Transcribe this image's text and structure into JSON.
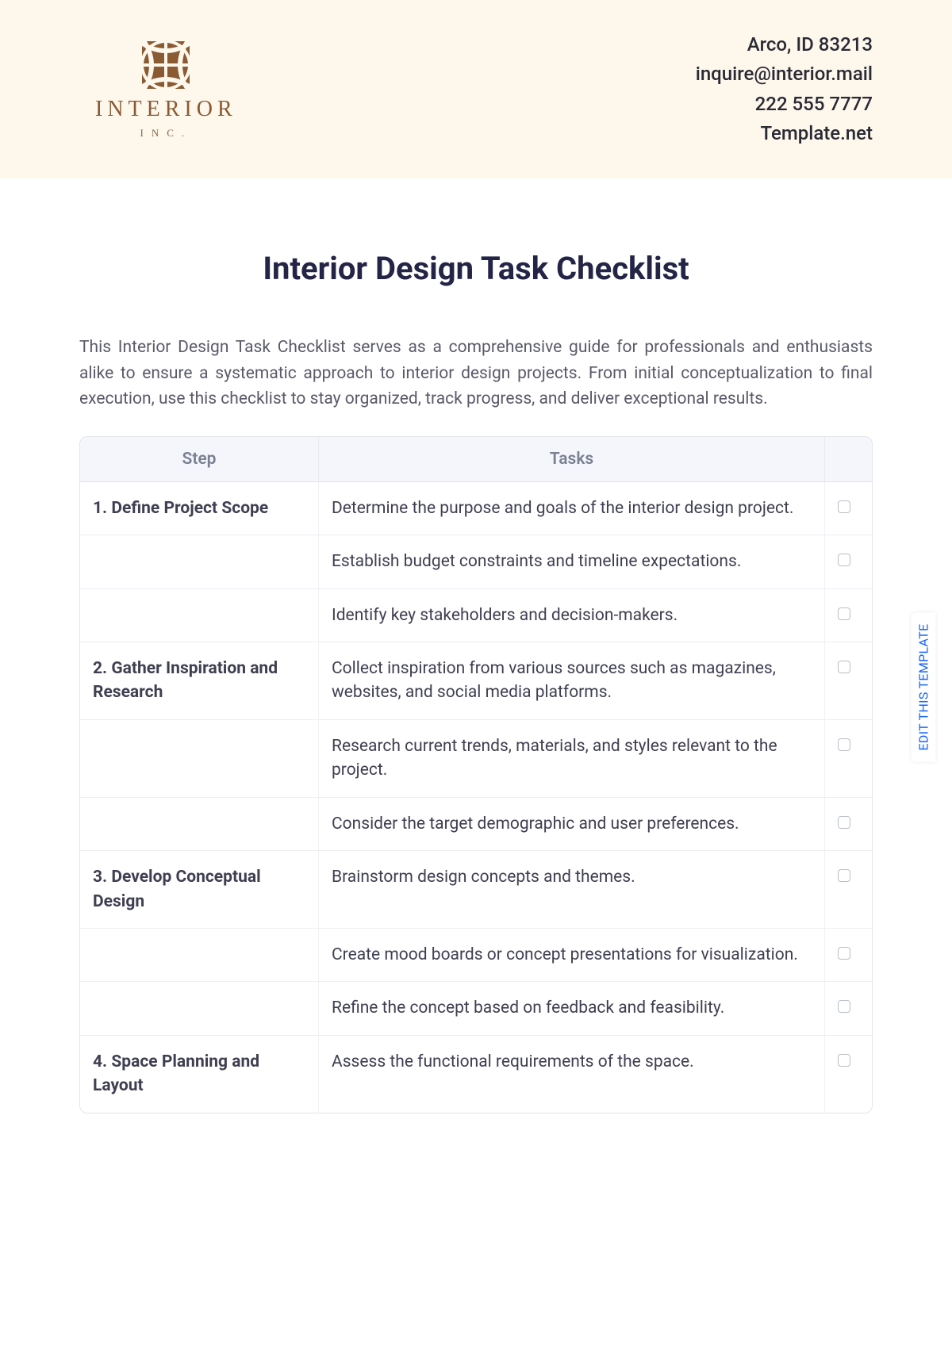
{
  "header": {
    "logo_word": "INTERIOR",
    "logo_sub": "INC.",
    "contact": {
      "address": "Arco, ID 83213",
      "email": "inquire@interior.mail",
      "phone": "222 555 7777",
      "site": "Template.net"
    }
  },
  "document": {
    "title": "Interior Design Task Checklist",
    "intro": "This Interior Design Task Checklist serves as a comprehensive guide for professionals and enthusiasts alike to ensure a systematic approach to interior design projects. From initial conceptualization to final execution, use this checklist to stay organized, track progress, and deliver exceptional results."
  },
  "table": {
    "headers": {
      "step": "Step",
      "tasks": "Tasks",
      "check": ""
    },
    "rows": [
      {
        "step": "1. Define Project Scope",
        "task": "Determine the purpose and goals of the interior design project."
      },
      {
        "step": "",
        "task": "Establish budget constraints and timeline expectations."
      },
      {
        "step": "",
        "task": "Identify key stakeholders and decision-makers."
      },
      {
        "step": "2. Gather Inspiration and Research",
        "task": "Collect inspiration from various sources such as magazines, websites, and social media platforms."
      },
      {
        "step": "",
        "task": "Research current trends, materials, and styles relevant to the project."
      },
      {
        "step": "",
        "task": "Consider the target demographic and user preferences."
      },
      {
        "step": "3. Develop Conceptual Design",
        "task": "Brainstorm design concepts and themes."
      },
      {
        "step": "",
        "task": "Create mood boards or concept presentations for visualization."
      },
      {
        "step": "",
        "task": "Refine the concept based on feedback and feasibility."
      },
      {
        "step": "4. Space Planning and Layout",
        "task": "Assess the functional requirements of the space."
      }
    ]
  },
  "edge_link": "EDIT THIS TEMPLATE"
}
